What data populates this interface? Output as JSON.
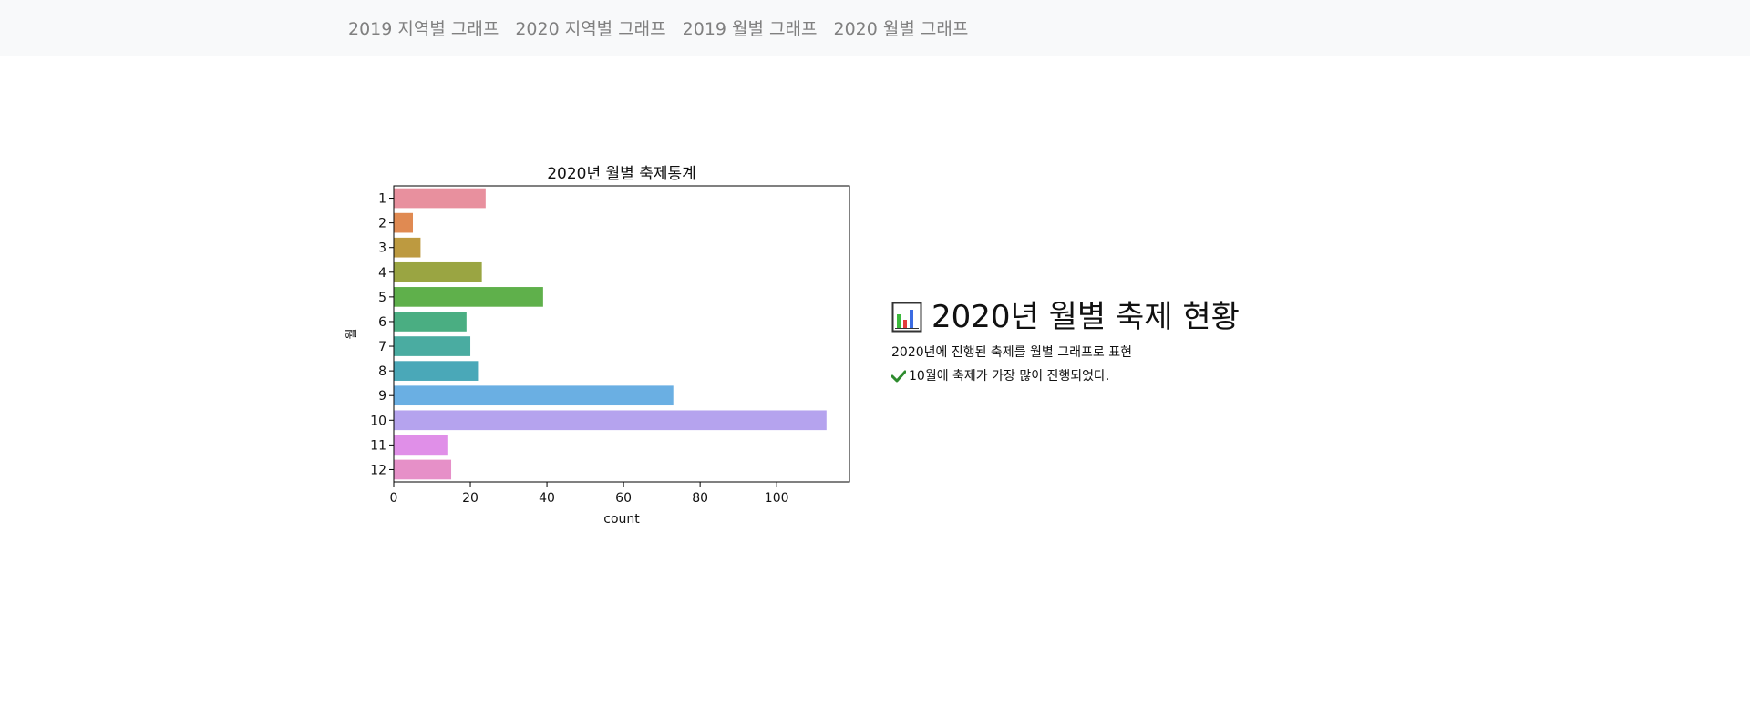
{
  "nav": {
    "items": [
      {
        "label": "2019 지역별 그래프"
      },
      {
        "label": "2020 지역별 그래프"
      },
      {
        "label": "2019 월별 그래프"
      },
      {
        "label": "2020 월별 그래프"
      }
    ]
  },
  "info": {
    "title": "2020년 월별 축제 현황",
    "description": "2020년에 진행된 축제를 월별 그래프로 표현",
    "highlight": "10월에 축제가 가장 많이 진행되었다.",
    "icons": {
      "title": "bar-chart-icon",
      "highlight": "check-icon"
    }
  },
  "chart_data": {
    "type": "bar",
    "orientation": "horizontal",
    "title": "2020년 월별 축제통계",
    "xlabel": "count",
    "ylabel": "월",
    "categories": [
      "1",
      "2",
      "3",
      "4",
      "5",
      "6",
      "7",
      "8",
      "9",
      "10",
      "11",
      "12"
    ],
    "values": [
      24,
      5,
      7,
      23,
      39,
      19,
      20,
      22,
      73,
      113,
      14,
      15
    ],
    "colors": [
      "#e8909e",
      "#e08a52",
      "#bd9a40",
      "#9aa542",
      "#5fb04b",
      "#4aae82",
      "#4aaca1",
      "#4aa8b8",
      "#6aafe3",
      "#b5a3ee",
      "#e08fe8",
      "#e690c8"
    ],
    "xlim": [
      0,
      119
    ],
    "xticks": [
      0,
      20,
      40,
      60,
      80,
      100
    ],
    "grid": false,
    "legend": "none"
  }
}
